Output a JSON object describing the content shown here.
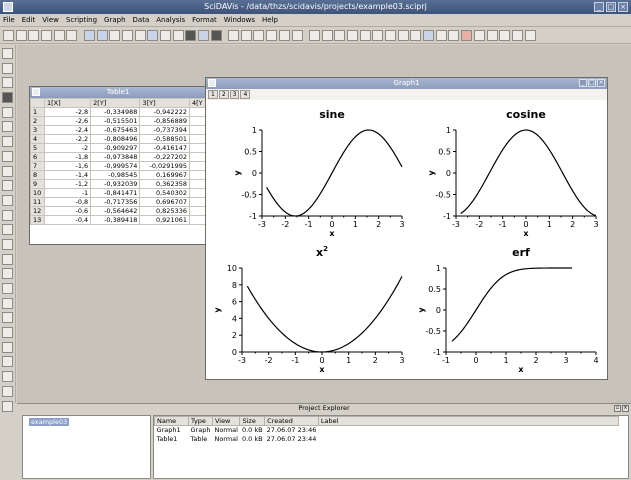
{
  "app": {
    "title": "SciDAVis - /data/thzs/scidavis/projects/example03.sciprj"
  },
  "menu": [
    "File",
    "Edit",
    "View",
    "Scripting",
    "Graph",
    "Data",
    "Analysis",
    "Format",
    "Windows",
    "Help"
  ],
  "table_window": {
    "title": "Table1",
    "columns": [
      "1[X]",
      "2[Y]",
      "3[Y]",
      "4[Y"
    ],
    "rows": [
      {
        "n": "1",
        "x": "-2,8",
        "y2": "-0,334988",
        "y3": "-0,942222"
      },
      {
        "n": "2",
        "x": "-2,6",
        "y2": "-0,515501",
        "y3": "-0,856889"
      },
      {
        "n": "3",
        "x": "-2,4",
        "y2": "-0,675463",
        "y3": "-0,737394"
      },
      {
        "n": "4",
        "x": "-2,2",
        "y2": "-0,808496",
        "y3": "-0,588501"
      },
      {
        "n": "5",
        "x": "-2",
        "y2": "-0,909297",
        "y3": "-0,416147"
      },
      {
        "n": "6",
        "x": "-1,8",
        "y2": "-0,973848",
        "y3": "-0,227202"
      },
      {
        "n": "7",
        "x": "-1,6",
        "y2": "-0,999574",
        "y3": "-0,0291995"
      },
      {
        "n": "8",
        "x": "-1,4",
        "y2": "-0,98545",
        "y3": "0,169967"
      },
      {
        "n": "9",
        "x": "-1,2",
        "y2": "-0,932039",
        "y3": "0,362358"
      },
      {
        "n": "10",
        "x": "-1",
        "y2": "-0,841471",
        "y3": "0,540302"
      },
      {
        "n": "11",
        "x": "-0,8",
        "y2": "-0,717356",
        "y3": "0,696707"
      },
      {
        "n": "12",
        "x": "-0,6",
        "y2": "-0,564642",
        "y3": "0,825336"
      },
      {
        "n": "13",
        "x": "-0,4",
        "y2": "-0,389418",
        "y3": "0,921061"
      }
    ]
  },
  "graph_window": {
    "title": "Graph1",
    "tabs": [
      "1",
      "2",
      "3",
      "4"
    ]
  },
  "chart_data": [
    {
      "type": "line",
      "title": "sine",
      "xlabel": "x",
      "ylabel": "y",
      "function": "sin",
      "xlim": [
        -3,
        3
      ],
      "ylim": [
        -1,
        1
      ],
      "x_range": [
        -2.8,
        3.0
      ],
      "xticks": [
        "-3",
        "-2",
        "-1",
        "0",
        "1",
        "2",
        "3"
      ],
      "yticks": [
        "1",
        "0.5",
        "0",
        "-0.5",
        "-1"
      ]
    },
    {
      "type": "line",
      "title": "cosine",
      "xlabel": "x",
      "ylabel": "y",
      "function": "cos",
      "xlim": [
        -3,
        3
      ],
      "ylim": [
        -1,
        1
      ],
      "x_range": [
        -2.8,
        3.0
      ],
      "xticks": [
        "-3",
        "-2",
        "-1",
        "0",
        "1",
        "2",
        "3"
      ],
      "yticks": [
        "1",
        "0.5",
        "0",
        "-0.5",
        "-1"
      ]
    },
    {
      "type": "line",
      "title_base": "x",
      "title_sup": "2",
      "xlabel": "x",
      "ylabel": "y",
      "function": "square",
      "xlim": [
        -3,
        3
      ],
      "ylim": [
        0,
        10
      ],
      "x_range": [
        -2.8,
        3.0
      ],
      "xticks": [
        "-3",
        "-2",
        "-1",
        "0",
        "1",
        "2",
        "3"
      ],
      "yticks": [
        "10",
        "8",
        "6",
        "4",
        "2",
        "0"
      ]
    },
    {
      "type": "line",
      "title": "erf",
      "xlabel": "x",
      "ylabel": "y",
      "function": "erf",
      "xlim": [
        -1,
        4
      ],
      "ylim": [
        -1,
        1
      ],
      "x_range": [
        -0.8,
        3.2
      ],
      "xticks": [
        "-1",
        "0",
        "1",
        "2",
        "3",
        "4"
      ],
      "yticks": [
        "1",
        "0.5",
        "0",
        "-0.5",
        "-1"
      ]
    }
  ],
  "project_explorer": {
    "title": "Project Explorer",
    "folder": "example03",
    "columns": [
      "Name",
      "Type",
      "View",
      "Size",
      "Created",
      "Label"
    ],
    "items": [
      {
        "name": "Graph1",
        "type": "Graph",
        "view": "Normal",
        "size": "0.0 kB",
        "created": "27.06.07 23:46",
        "label": ""
      },
      {
        "name": "Table1",
        "type": "Table",
        "view": "Normal",
        "size": "0.0 kB",
        "created": "27.06.07 23:44",
        "label": ""
      }
    ]
  }
}
